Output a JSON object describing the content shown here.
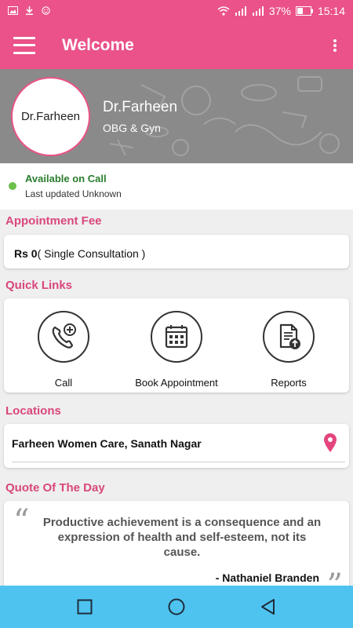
{
  "status_bar": {
    "battery": "37%",
    "time": "15:14"
  },
  "app_bar": {
    "title": "Welcome"
  },
  "profile": {
    "avatar_text": "Dr.Farheen",
    "name": "Dr.Farheen",
    "specialty": "OBG & Gyn"
  },
  "availability": {
    "status": "Available on Call",
    "updated": "Last updated Unknown",
    "status_color": "#6cc04a"
  },
  "fee": {
    "heading": "Appointment Fee",
    "amount": "Rs 0",
    "detail": "( Single Consultation )"
  },
  "quick_links": {
    "heading": "Quick Links",
    "items": [
      {
        "label": "Call",
        "icon": "phone-plus-icon"
      },
      {
        "label": "Book Appointment",
        "icon": "calendar-icon"
      },
      {
        "label": "Reports",
        "icon": "report-upload-icon"
      }
    ]
  },
  "locations": {
    "heading": "Locations",
    "items": [
      {
        "name": "Farheen Women Care, Sanath Nagar",
        "icon": "map-pin-icon"
      }
    ]
  },
  "quote": {
    "heading": "Quote Of The Day",
    "text": "Productive achievement is a consequence and an expression of health and self-esteem, not its cause.",
    "author": "- Nathaniel Branden"
  },
  "nav": {
    "items": [
      "recents-icon",
      "home-icon",
      "back-icon"
    ]
  },
  "colors": {
    "primary": "#ea5289",
    "section_heading": "#d9477c",
    "nav_bar": "#4fc3f0"
  }
}
